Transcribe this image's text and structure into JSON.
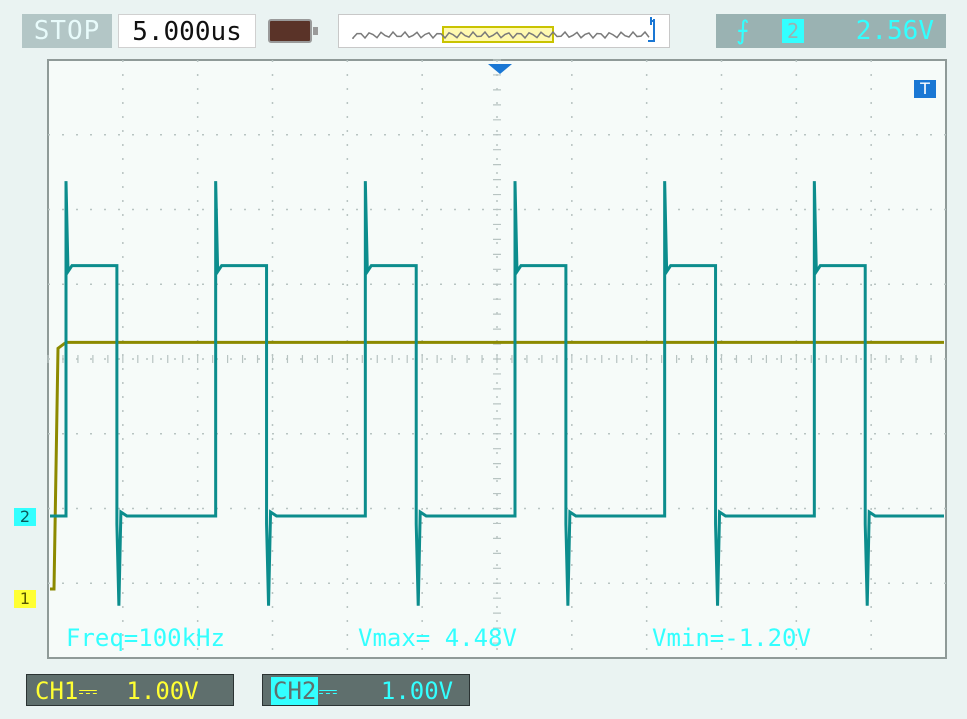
{
  "status": {
    "run_state": "STOP",
    "timebase": "5.000us"
  },
  "trigger": {
    "edge_symbol": "⨍",
    "channel": "2",
    "level": "2.56V"
  },
  "markers": {
    "trigger_pos": "T",
    "ch2": "2",
    "ch1": "1"
  },
  "measurements": {
    "freq": "Freq=100kHz",
    "vmax": "Vmax= 4.48V",
    "vmin": "Vmin=-1.20V"
  },
  "channels": {
    "ch1": {
      "name": "CH1",
      "coupling": "⎓",
      "scale": "1.00V",
      "color": "#ffff33"
    },
    "ch2": {
      "name": "CH2",
      "coupling": "⎓",
      "scale": "1.00V",
      "color": "#33ffff"
    }
  },
  "colors": {
    "ch1_trace": "#8c8a00",
    "ch2_trace": "#0c8d8d",
    "grid_bg": "#f6fbf9"
  },
  "chart_data": {
    "type": "line",
    "divisions": {
      "x": 12,
      "y": 8
    },
    "series": [
      {
        "values": {
          "period_us": 10,
          "duty": 0.34,
          "high_v": 3.35,
          "low_v": 0.0,
          "overshoot_v": 4.48,
          "undershoot_v": -1.2
        }
      },
      {
        "values": {
          "level_v": 3.3,
          "step_time_us": 0.1
        }
      }
    ]
  }
}
